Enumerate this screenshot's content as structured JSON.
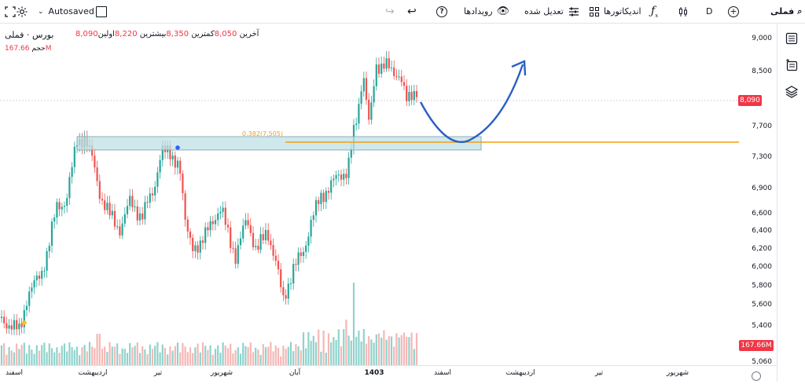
{
  "toolbar": {
    "symbol": "فملی",
    "interval": "D",
    "indicators_label": "اندیکاتورها",
    "adjusted_label": "تعدیل شده",
    "events_label": "رویدادها",
    "autosave_label": "Autosaved"
  },
  "legend": {
    "symbol_name": "فملی",
    "exchange": "بورس",
    "separator": "·",
    "open_label": "اولین",
    "open_value": "8,220",
    "high_label": "بیشترین",
    "high_value": "8,350",
    "low_label": "کمترین",
    "low_value": "8,050",
    "close_label": "آخرین",
    "close_value": "8,090",
    "volume_label": "حجم",
    "volume_value": "167.66M"
  },
  "y_axis": {
    "ticks": [
      "9,000",
      "8,500",
      "7,700",
      "7,300",
      "6,900",
      "6,600",
      "6,400",
      "6,200",
      "6,000",
      "5,800",
      "5,600",
      "5,400",
      "5,060"
    ],
    "last_price": "8,090",
    "last_volume": "167.66M",
    "price_color": "#f23645",
    "volume_tag_color": "#f23645"
  },
  "x_axis": {
    "ticks": [
      "اسفند",
      "اردیبهشت",
      "تیر",
      "شهریور",
      "آبان",
      "1403",
      "اسفند",
      "اردیبهشت",
      "تیر",
      "شهریور"
    ]
  },
  "annotation": {
    "fib_text": "0.382(7,505)",
    "zone_color": "#bfe0e6",
    "line_color": "#f59e0b",
    "arrow_color": "#2a5fc4"
  },
  "colors": {
    "up": "#26a69a",
    "down": "#ef5350"
  }
}
